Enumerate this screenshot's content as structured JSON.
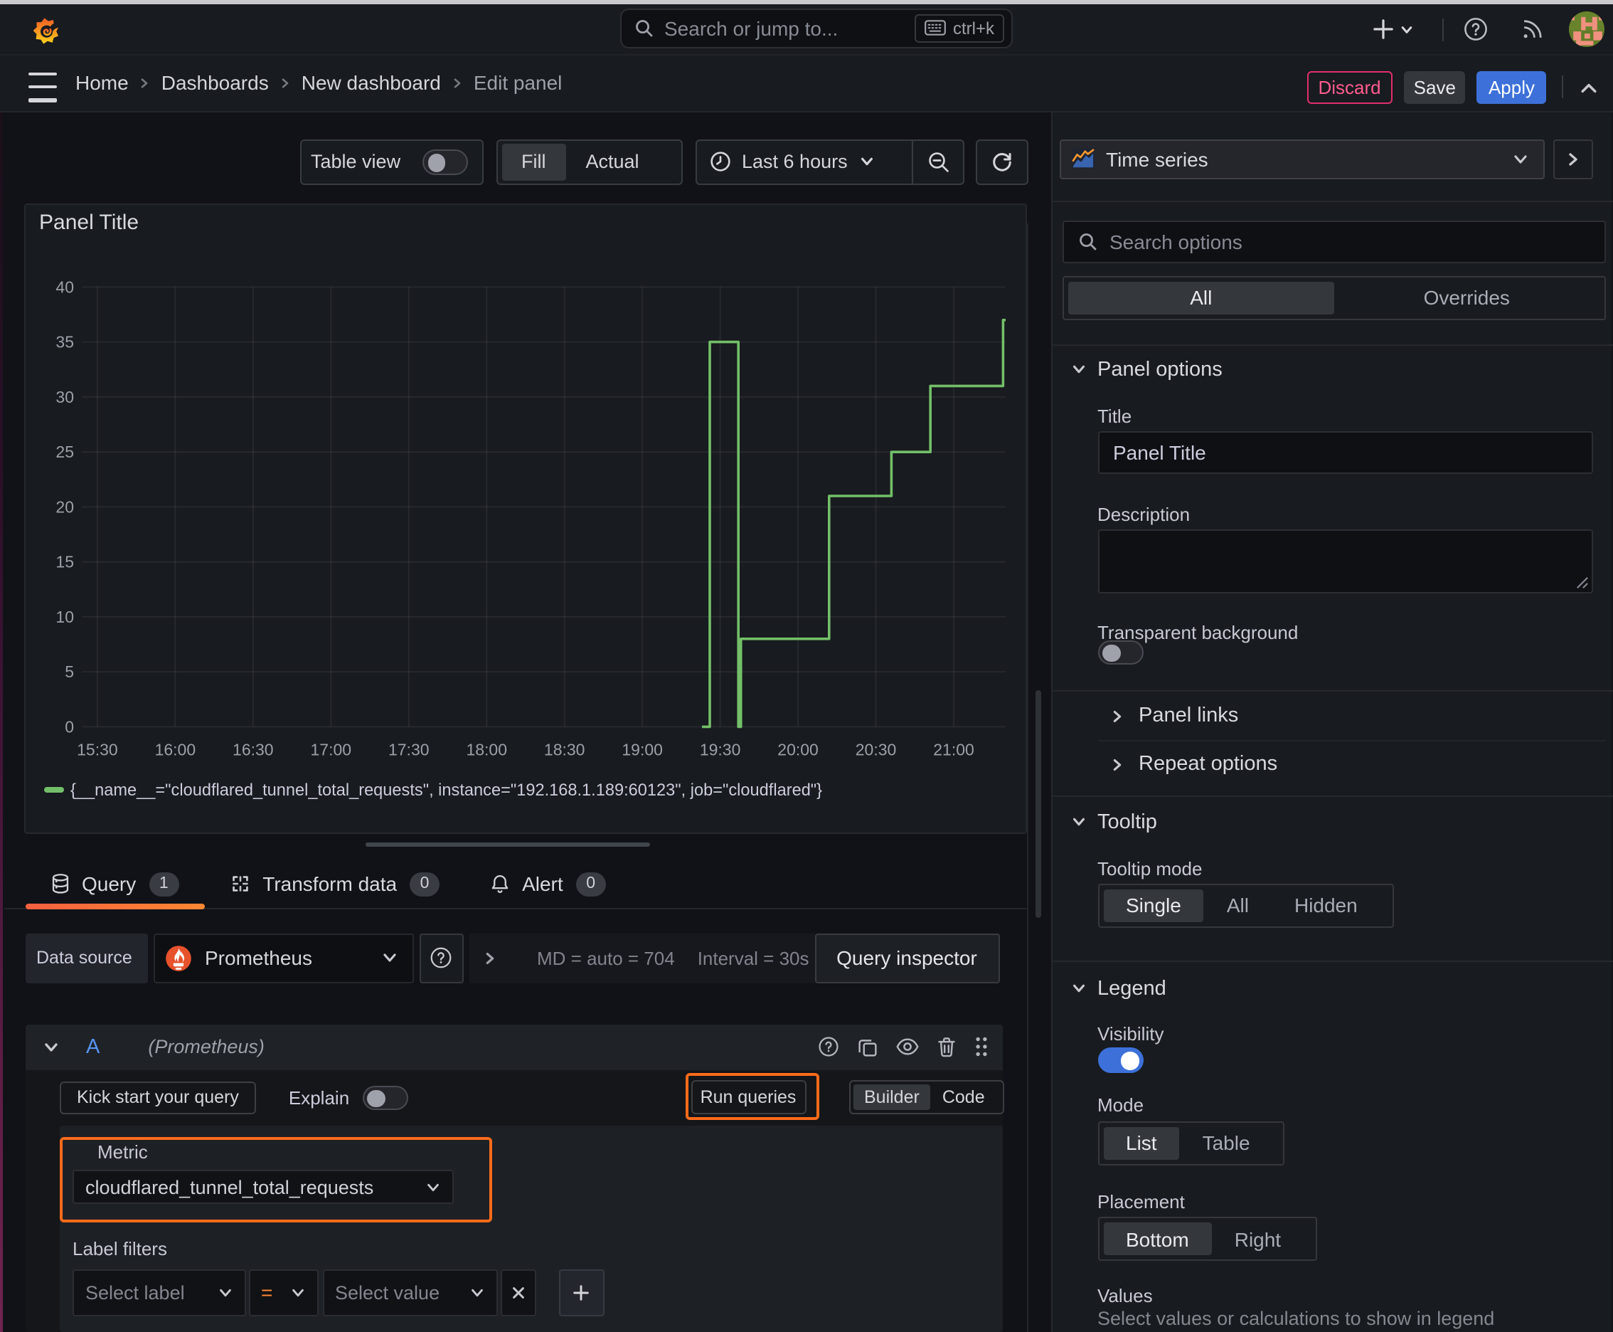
{
  "topnav": {
    "search_placeholder": "Search or jump to...",
    "search_shortcut": "ctrl+k"
  },
  "breadcrumb": {
    "items": [
      "Home",
      "Dashboards",
      "New dashboard"
    ],
    "current": "Edit panel"
  },
  "header_actions": {
    "discard": "Discard",
    "save": "Save",
    "apply": "Apply"
  },
  "toolbar": {
    "table_view_label": "Table view",
    "table_view_on": false,
    "display_options": [
      "Fill",
      "Actual"
    ],
    "display_selected": "Fill",
    "time_range": "Last 6 hours"
  },
  "panel": {
    "title": "Panel Title",
    "legend": "{__name__=\"cloudflared_tunnel_total_requests\", instance=\"192.168.1.189:60123\", job=\"cloudflared\"}"
  },
  "chart_data": {
    "type": "line",
    "step": true,
    "title": "Panel Title",
    "xlabel": "",
    "ylabel": "",
    "x_domain": [
      "15:24",
      "21:20"
    ],
    "ylim": [
      0,
      40
    ],
    "x_ticks": [
      "15:30",
      "16:00",
      "16:30",
      "17:00",
      "17:30",
      "18:00",
      "18:30",
      "19:00",
      "19:30",
      "20:00",
      "20:30",
      "21:00"
    ],
    "y_ticks": [
      0,
      5,
      10,
      15,
      20,
      25,
      30,
      35,
      40
    ],
    "grid": true,
    "legend_position": "bottom",
    "series": [
      {
        "name": "{__name__=\"cloudflared_tunnel_total_requests\", instance=\"192.168.1.189:60123\", job=\"cloudflared\"}",
        "color": "#73bf69",
        "points": [
          [
            "19:23",
            0
          ],
          [
            "19:26",
            35
          ],
          [
            "19:37",
            0
          ],
          [
            "19:38",
            8
          ],
          [
            "20:12",
            21
          ],
          [
            "20:36",
            25
          ],
          [
            "20:51",
            31
          ],
          [
            "21:19",
            37
          ],
          [
            "21:20",
            37
          ]
        ]
      }
    ],
    "colors": {
      "grid": "rgba(204,204,220,0.08)",
      "tick_label": "#9da0a8"
    }
  },
  "query_tabs": {
    "tabs": [
      {
        "label": "Query",
        "badge": "1",
        "active": true
      },
      {
        "label": "Transform data",
        "badge": "0",
        "active": false
      },
      {
        "label": "Alert",
        "badge": "0",
        "active": false
      }
    ]
  },
  "datasource_row": {
    "label": "Data source",
    "value": "Prometheus",
    "stat_md": "MD = auto = 704",
    "stat_interval": "Interval = 30s",
    "inspector": "Query inspector"
  },
  "query_row": {
    "ref_id": "A",
    "datasource_hint": "(Prometheus)",
    "kick_start": "Kick start your query",
    "explain_label": "Explain",
    "explain_on": false,
    "run_queries": "Run queries",
    "editor_modes": [
      "Builder",
      "Code"
    ],
    "editor_mode_selected": "Builder"
  },
  "builder": {
    "metric_label": "Metric",
    "metric_value": "cloudflared_tunnel_total_requests",
    "label_filters_label": "Label filters",
    "select_label_placeholder": "Select label",
    "operator": "=",
    "select_value_placeholder": "Select value"
  },
  "sidebar": {
    "visualization": "Time series",
    "search_placeholder": "Search options",
    "filter_tabs": [
      "All",
      "Overrides"
    ],
    "filter_selected": "All",
    "panel_options": {
      "title": "Panel options",
      "title_label": "Title",
      "title_value": "Panel Title",
      "description_label": "Description",
      "description_value": "",
      "transparent_label": "Transparent background",
      "transparent_on": false
    },
    "links_section": "Panel links",
    "repeat_section": "Repeat options",
    "tooltip": {
      "title": "Tooltip",
      "mode_label": "Tooltip mode",
      "modes": [
        "Single",
        "All",
        "Hidden"
      ],
      "mode_selected": "Single"
    },
    "legend": {
      "title": "Legend",
      "visibility_label": "Visibility",
      "visibility_on": true,
      "mode_label": "Mode",
      "modes": [
        "List",
        "Table"
      ],
      "mode_selected": "List",
      "placement_label": "Placement",
      "placements": [
        "Bottom",
        "Right"
      ],
      "placement_selected": "Bottom",
      "values_label": "Values",
      "values_helper": "Select values or calculations to show in legend"
    }
  },
  "annotations": {
    "highlight_color": "#ff6b1a",
    "highlighted": [
      "run-queries-button",
      "metric-section"
    ]
  },
  "colors": {
    "canvas": "#111217",
    "surface": "#181b1f",
    "accent_blue": "#3d71d9",
    "accent_orange": "#ff8833",
    "series_green": "#73bf69",
    "destructive_pink": "#ff5c8f"
  }
}
